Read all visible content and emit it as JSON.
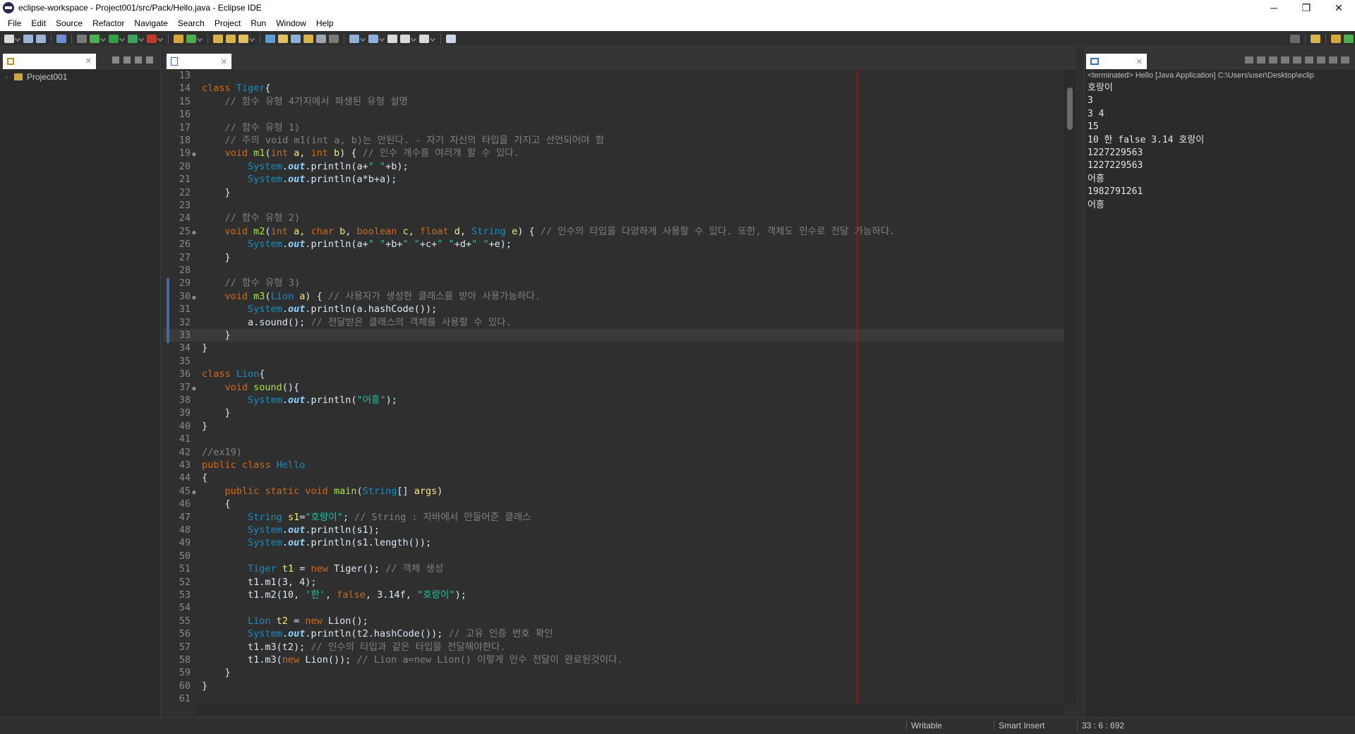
{
  "window": {
    "title": "eclipse-workspace - Project001/src/Pack/Hello.java - Eclipse IDE",
    "minimize": "─",
    "maximize": "❐",
    "close": "✕"
  },
  "menu": [
    "File",
    "Edit",
    "Source",
    "Refactor",
    "Navigate",
    "Search",
    "Project",
    "Run",
    "Window",
    "Help"
  ],
  "explorer": {
    "tab_close": "✕",
    "project": "Project001"
  },
  "editor": {
    "tab_close": "✕",
    "current_line": 33
  },
  "code_lines": [
    {
      "n": "13",
      "m": "",
      "t": [
        [
          "plain",
          ""
        ]
      ]
    },
    {
      "n": "14",
      "m": "",
      "t": [
        [
          "kw",
          "class "
        ],
        [
          "cls",
          "Tiger"
        ],
        [
          "plain",
          "{"
        ]
      ]
    },
    {
      "n": "15",
      "m": "",
      "t": [
        [
          "plain",
          "    "
        ],
        [
          "cmt",
          "// 함수 유형 4가지에서 파생된 유형 설명"
        ]
      ]
    },
    {
      "n": "16",
      "m": "",
      "t": [
        [
          "plain",
          ""
        ]
      ]
    },
    {
      "n": "17",
      "m": "",
      "t": [
        [
          "plain",
          "    "
        ],
        [
          "cmt",
          "// 함수 유형 1)"
        ]
      ]
    },
    {
      "n": "18",
      "m": "",
      "t": [
        [
          "plain",
          "    "
        ],
        [
          "cmt",
          "// 주의 void m1(int a, b)는 안된다. - 자기 자신의 타입을 가지고 선언되어야 함"
        ]
      ]
    },
    {
      "n": "19",
      "m": "●",
      "t": [
        [
          "plain",
          "    "
        ],
        [
          "kw",
          "void "
        ],
        [
          "fn",
          "m1"
        ],
        [
          "plain",
          "("
        ],
        [
          "kw",
          "int "
        ],
        [
          "var",
          "a"
        ],
        [
          "plain",
          ", "
        ],
        [
          "kw",
          "int "
        ],
        [
          "var",
          "b"
        ],
        [
          "plain",
          ") { "
        ],
        [
          "cmt",
          "// 인수 개수를 여러개 할 수 있다."
        ]
      ]
    },
    {
      "n": "20",
      "m": "",
      "t": [
        [
          "plain",
          "        "
        ],
        [
          "cls",
          "System"
        ],
        [
          "plain",
          "."
        ],
        [
          "fld",
          "out"
        ],
        [
          "plain",
          ".println(a+"
        ],
        [
          "str",
          "\" \""
        ],
        [
          "plain",
          "+b);"
        ]
      ]
    },
    {
      "n": "21",
      "m": "",
      "t": [
        [
          "plain",
          "        "
        ],
        [
          "cls",
          "System"
        ],
        [
          "plain",
          "."
        ],
        [
          "fld",
          "out"
        ],
        [
          "plain",
          ".println(a*b+a);"
        ]
      ]
    },
    {
      "n": "22",
      "m": "",
      "t": [
        [
          "plain",
          "    }"
        ]
      ]
    },
    {
      "n": "23",
      "m": "",
      "t": [
        [
          "plain",
          ""
        ]
      ]
    },
    {
      "n": "24",
      "m": "",
      "t": [
        [
          "plain",
          "    "
        ],
        [
          "cmt",
          "// 함수 유형 2)"
        ]
      ]
    },
    {
      "n": "25",
      "m": "●",
      "t": [
        [
          "plain",
          "    "
        ],
        [
          "kw",
          "void "
        ],
        [
          "fn",
          "m2"
        ],
        [
          "plain",
          "("
        ],
        [
          "kw",
          "int "
        ],
        [
          "var",
          "a"
        ],
        [
          "plain",
          ", "
        ],
        [
          "kw",
          "char "
        ],
        [
          "var",
          "b"
        ],
        [
          "plain",
          ", "
        ],
        [
          "kw",
          "boolean "
        ],
        [
          "var",
          "c"
        ],
        [
          "plain",
          ", "
        ],
        [
          "kw",
          "float "
        ],
        [
          "var",
          "d"
        ],
        [
          "plain",
          ", "
        ],
        [
          "cls",
          "String "
        ],
        [
          "var",
          "e"
        ],
        [
          "plain",
          ") { "
        ],
        [
          "cmt",
          "// 인수의 타입을 다양하게 사용할 수 있다. 또한, 객체도 인수로 전달 가능하다."
        ]
      ]
    },
    {
      "n": "26",
      "m": "",
      "t": [
        [
          "plain",
          "        "
        ],
        [
          "cls",
          "System"
        ],
        [
          "plain",
          "."
        ],
        [
          "fld",
          "out"
        ],
        [
          "plain",
          ".println(a+"
        ],
        [
          "str",
          "\" \""
        ],
        [
          "plain",
          "+b+"
        ],
        [
          "str",
          "\" \""
        ],
        [
          "plain",
          "+c+"
        ],
        [
          "str",
          "\" \""
        ],
        [
          "plain",
          "+d+"
        ],
        [
          "str",
          "\" \""
        ],
        [
          "plain",
          "+e);"
        ]
      ]
    },
    {
      "n": "27",
      "m": "",
      "t": [
        [
          "plain",
          "    }"
        ]
      ]
    },
    {
      "n": "28",
      "m": "",
      "t": [
        [
          "plain",
          ""
        ]
      ]
    },
    {
      "n": "29",
      "m": "",
      "t": [
        [
          "plain",
          "    "
        ],
        [
          "cmt",
          "// 함수 유형 3)"
        ]
      ]
    },
    {
      "n": "30",
      "m": "●",
      "t": [
        [
          "plain",
          "    "
        ],
        [
          "kw",
          "void "
        ],
        [
          "fn",
          "m3"
        ],
        [
          "plain",
          "("
        ],
        [
          "cls",
          "Lion "
        ],
        [
          "var",
          "a"
        ],
        [
          "plain",
          ") { "
        ],
        [
          "cmt",
          "// 사용자가 생성한 클래스를 받아 사용가능하다."
        ]
      ]
    },
    {
      "n": "31",
      "m": "",
      "t": [
        [
          "plain",
          "        "
        ],
        [
          "cls",
          "System"
        ],
        [
          "plain",
          "."
        ],
        [
          "fld",
          "out"
        ],
        [
          "plain",
          ".println(a.hashCode());"
        ]
      ]
    },
    {
      "n": "32",
      "m": "",
      "t": [
        [
          "plain",
          "        a.sound(); "
        ],
        [
          "cmt",
          "// 전달받은 클래스의 객체를 사용할 수 있다."
        ]
      ]
    },
    {
      "n": "33",
      "m": "",
      "t": [
        [
          "plain",
          "    }"
        ]
      ]
    },
    {
      "n": "34",
      "m": "",
      "t": [
        [
          "plain",
          "}"
        ]
      ]
    },
    {
      "n": "35",
      "m": "",
      "t": [
        [
          "plain",
          ""
        ]
      ]
    },
    {
      "n": "36",
      "m": "",
      "t": [
        [
          "kw",
          "class "
        ],
        [
          "cls",
          "Lion"
        ],
        [
          "plain",
          "{"
        ]
      ]
    },
    {
      "n": "37",
      "m": "●",
      "t": [
        [
          "plain",
          "    "
        ],
        [
          "kw",
          "void "
        ],
        [
          "fn",
          "sound"
        ],
        [
          "plain",
          "(){"
        ]
      ]
    },
    {
      "n": "38",
      "m": "",
      "t": [
        [
          "plain",
          "        "
        ],
        [
          "cls",
          "System"
        ],
        [
          "plain",
          "."
        ],
        [
          "fld",
          "out"
        ],
        [
          "plain",
          ".println("
        ],
        [
          "str",
          "\"어흥\""
        ],
        [
          "plain",
          ");"
        ]
      ]
    },
    {
      "n": "39",
      "m": "",
      "t": [
        [
          "plain",
          "    }"
        ]
      ]
    },
    {
      "n": "40",
      "m": "",
      "t": [
        [
          "plain",
          "}"
        ]
      ]
    },
    {
      "n": "41",
      "m": "",
      "t": [
        [
          "plain",
          ""
        ]
      ]
    },
    {
      "n": "42",
      "m": "",
      "t": [
        [
          "cmt",
          "//ex19)"
        ]
      ]
    },
    {
      "n": "43",
      "m": "",
      "t": [
        [
          "kw",
          "public class "
        ],
        [
          "cls",
          "Hello"
        ]
      ]
    },
    {
      "n": "44",
      "m": "",
      "t": [
        [
          "plain",
          "{"
        ]
      ]
    },
    {
      "n": "45",
      "m": "●",
      "t": [
        [
          "plain",
          "    "
        ],
        [
          "kw",
          "public static void "
        ],
        [
          "fn",
          "main"
        ],
        [
          "plain",
          "("
        ],
        [
          "cls",
          "String"
        ],
        [
          "plain",
          "[] "
        ],
        [
          "var",
          "args"
        ],
        [
          "plain",
          ")"
        ]
      ]
    },
    {
      "n": "46",
      "m": "",
      "t": [
        [
          "plain",
          "    {"
        ]
      ]
    },
    {
      "n": "47",
      "m": "",
      "t": [
        [
          "plain",
          "        "
        ],
        [
          "cls",
          "String "
        ],
        [
          "var",
          "s1"
        ],
        [
          "plain",
          "="
        ],
        [
          "str",
          "\"호랑이\""
        ],
        [
          "plain",
          "; "
        ],
        [
          "cmt",
          "// String : 자바에서 만들어준 클래스"
        ]
      ]
    },
    {
      "n": "48",
      "m": "",
      "t": [
        [
          "plain",
          "        "
        ],
        [
          "cls",
          "System"
        ],
        [
          "plain",
          "."
        ],
        [
          "fld",
          "out"
        ],
        [
          "plain",
          ".println(s1);"
        ]
      ]
    },
    {
      "n": "49",
      "m": "",
      "t": [
        [
          "plain",
          "        "
        ],
        [
          "cls",
          "System"
        ],
        [
          "plain",
          "."
        ],
        [
          "fld",
          "out"
        ],
        [
          "plain",
          ".println(s1.length());"
        ]
      ]
    },
    {
      "n": "50",
      "m": "",
      "t": [
        [
          "plain",
          ""
        ]
      ]
    },
    {
      "n": "51",
      "m": "",
      "t": [
        [
          "plain",
          "        "
        ],
        [
          "cls",
          "Tiger "
        ],
        [
          "var",
          "t1"
        ],
        [
          "plain",
          " = "
        ],
        [
          "kw",
          "new "
        ],
        [
          "plain",
          "Tiger(); "
        ],
        [
          "cmt",
          "// 객체 생성"
        ]
      ]
    },
    {
      "n": "52",
      "m": "",
      "t": [
        [
          "plain",
          "        t1.m1(3, 4);"
        ]
      ]
    },
    {
      "n": "53",
      "m": "",
      "t": [
        [
          "plain",
          "        t1.m2(10, "
        ],
        [
          "str",
          "'한'"
        ],
        [
          "plain",
          ", "
        ],
        [
          "kw",
          "false"
        ],
        [
          "plain",
          ", 3.14f, "
        ],
        [
          "str",
          "\"호랑이\""
        ],
        [
          "plain",
          ");"
        ]
      ]
    },
    {
      "n": "54",
      "m": "",
      "t": [
        [
          "plain",
          ""
        ]
      ]
    },
    {
      "n": "55",
      "m": "",
      "t": [
        [
          "plain",
          "        "
        ],
        [
          "cls",
          "Lion "
        ],
        [
          "var",
          "t2"
        ],
        [
          "plain",
          " = "
        ],
        [
          "kw",
          "new "
        ],
        [
          "plain",
          "Lion();"
        ]
      ]
    },
    {
      "n": "56",
      "m": "",
      "t": [
        [
          "plain",
          "        "
        ],
        [
          "cls",
          "System"
        ],
        [
          "plain",
          "."
        ],
        [
          "fld",
          "out"
        ],
        [
          "plain",
          ".println(t2.hashCode()); "
        ],
        [
          "cmt",
          "// 고유 인증 번호 확인"
        ]
      ]
    },
    {
      "n": "57",
      "m": "",
      "t": [
        [
          "plain",
          "        t1.m3(t2); "
        ],
        [
          "cmt",
          "// 인수의 타입과 같은 타입을 전달해야한다."
        ]
      ]
    },
    {
      "n": "58",
      "m": "",
      "t": [
        [
          "plain",
          "        t1.m3("
        ],
        [
          "kw",
          "new "
        ],
        [
          "plain",
          "Lion()); "
        ],
        [
          "cmt",
          "// Lion a=new Lion() 이렇게 인수 전달이 완료된것이다."
        ]
      ]
    },
    {
      "n": "59",
      "m": "",
      "t": [
        [
          "plain",
          "    }"
        ]
      ]
    },
    {
      "n": "60",
      "m": "",
      "t": [
        [
          "plain",
          "}"
        ]
      ]
    },
    {
      "n": "61",
      "m": "",
      "t": [
        [
          "plain",
          ""
        ]
      ]
    }
  ],
  "console": {
    "tab_close": "✕",
    "status": "<terminated> Hello [Java Application] C:\\Users\\user\\Desktop\\eclip",
    "output": [
      "호랑이",
      "3",
      "3 4",
      "15",
      "10 한 false 3.14 호랑이",
      "1227229563",
      "1227229563",
      "어흥",
      "1982791261",
      "어흥"
    ]
  },
  "statusbar": {
    "writable": "Writable",
    "insert_mode": "Smart Insert",
    "position": "33 : 6 : 692"
  }
}
